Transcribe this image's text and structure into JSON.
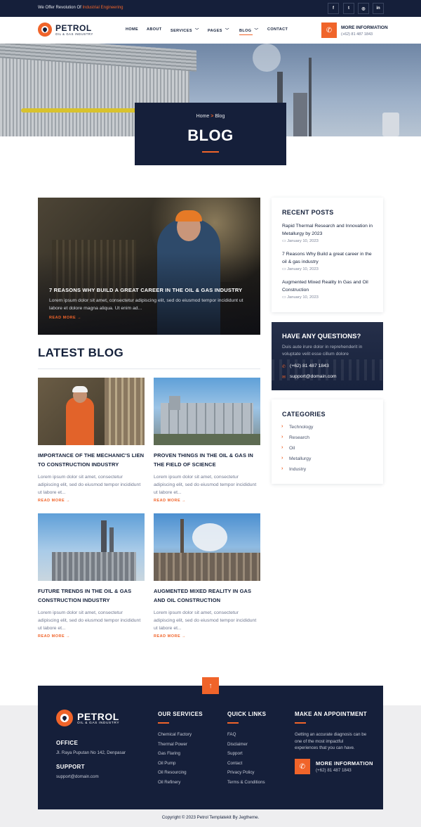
{
  "topbar": {
    "tagline_prefix": "We Offer Revolution Of ",
    "tagline_highlight": "Industrial Engineering",
    "social": [
      "f",
      "t",
      "ig",
      "in"
    ]
  },
  "header": {
    "logo_name": "PETROL",
    "logo_sub": "OIL & GAS INDUSTRY",
    "nav": [
      "HOME",
      "ABOUT",
      "SERVICES",
      "PAGES",
      "BLOG",
      "CONTACT"
    ],
    "active_nav": "BLOG",
    "info_title": "MORE INFORMATION",
    "info_phone": "(+62) 81 487 1843"
  },
  "banner": {
    "crumb_home": "Home",
    "crumb_sep": ">",
    "crumb_current": "Blog",
    "title": "BLOG"
  },
  "featured": {
    "title": "7 REASONS WHY BUILD A GREAT CAREER IN THE OIL & GAS INDUSTRY",
    "excerpt": "Lorem ipsum dolor sit amet, consectetur adipiscing elit, sed do eiusmod tempor incididunt ut labore et dolore magna aliqua. Ut enim ad...",
    "more": "READ MORE →"
  },
  "latest": {
    "heading": "LATEST BLOG",
    "posts": [
      {
        "title": "IMPORTANCE OF THE MECHANIC'S LIEN TO CONSTRUCTION INDUSTRY",
        "excerpt": "Lorem ipsum dolor sit amet, consectetur adipiscing elit, sed do eiusmod tempor incididunt ut labore et...",
        "more": "READ MORE →"
      },
      {
        "title": "PROVEN THINGS IN THE OIL & GAS IN THE FIELD OF SCIENCE",
        "excerpt": "Lorem ipsum dolor sit amet, consectetur adipiscing elit, sed do eiusmod tempor incididunt ut labore et...",
        "more": "READ MORE →"
      },
      {
        "title": "FUTURE TRENDS IN THE OIL & GAS CONSTRUCTION INDUSTRY",
        "excerpt": "Lorem ipsum dolor sit amet, consectetur adipiscing elit, sed do eiusmod tempor incididunt ut labore et...",
        "more": "READ MORE →"
      },
      {
        "title": "AUGMENTED MIXED REALITY IN GAS AND OIL CONSTRUCTION",
        "excerpt": "Lorem ipsum dolor sit amet, consectetur adipiscing elit, sed do eiusmod tempor incididunt ut labore et...",
        "more": "READ MORE →"
      }
    ]
  },
  "recent": {
    "heading": "RECENT POSTS",
    "posts": [
      {
        "title": "Rapid Thermal Research and Innovation in Metallurgy by 2023",
        "date": "January 10, 2023"
      },
      {
        "title": "7 Reasons Why Build a great career in the oil & gas industry",
        "date": "January 10, 2023"
      },
      {
        "title": "Augmented Mixed Reality In Gas and Oil Construction",
        "date": "January 10, 2023"
      }
    ]
  },
  "question": {
    "heading": "HAVE ANY QUESTIONS?",
    "desc": "Duis aute irure dolor in reprehenderit in voluptate velit esse cillum dolore",
    "phone": "(+62) 81 487 1843",
    "email": "support@domain.com"
  },
  "categories": {
    "heading": "CATEGORIES",
    "items": [
      "Technology",
      "Research",
      "Oil",
      "Metallurgy",
      "Industry"
    ]
  },
  "footer": {
    "logo_name": "PETROL",
    "logo_sub": "OIL & GAS INDUSTRY",
    "office_heading": "OFFICE",
    "office_address": "Jl. Raya Puputan No 142, Denpasar",
    "support_heading": "SUPPORT",
    "support_email": "support@domain.com",
    "services_heading": "OUR SERVICES",
    "services": [
      "Chemical Factory",
      "Thermal Power",
      "Gas Flaring",
      "Oil Pump",
      "Oil Resourcing",
      "Oil Refinery"
    ],
    "links_heading": "QUICK LINKS",
    "links": [
      "FAQ",
      "Disclaimer",
      "Support",
      "Contact",
      "Privacy Policy",
      "Terms & Conditions"
    ],
    "appointment_heading": "MAKE AN APPOINTMENT",
    "appointment_desc": "Getting an accurate diagnosis can be one of the most impactful experiences that you can have.",
    "info_title": "MORE INFORMATION",
    "info_phone": "(+62) 81 487 1843",
    "copyright": "Copyright © 2023 Petrol Templatekit By Jegtheme."
  },
  "colors": {
    "accent": "#f0642a",
    "navy": "#151f3a"
  }
}
